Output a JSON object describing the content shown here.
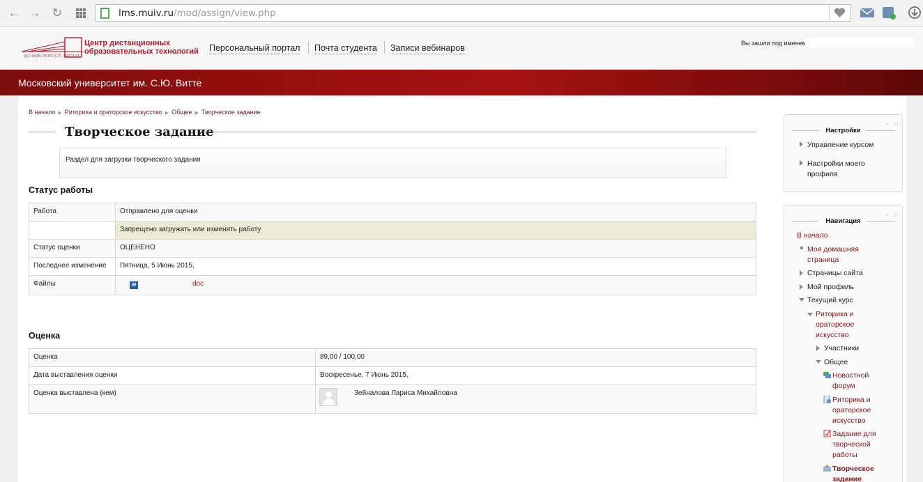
{
  "browser": {
    "url_host": "lms.muiv.ru",
    "url_path": "/mod/assign/view.php"
  },
  "header": {
    "logo_line1": "Центр дистанционных",
    "logo_line2": "образовательных технологий",
    "logo_motto": "QUI NON PROFICIT, DEFICIT",
    "nav": [
      "Персональный портал",
      "Почта студента",
      "Записи вебинаров"
    ],
    "login_label": "Вы зашли под именем"
  },
  "banner": {
    "title": "Московский университет им. С.Ю. Витте"
  },
  "breadcrumb": [
    "В начало",
    "Риторика и ораторское искусство",
    "Общее",
    "Творческое задание"
  ],
  "page": {
    "title": "Творческое задание",
    "intro": "Раздел для загрузки творческого задания"
  },
  "status": {
    "heading": "Статус работы",
    "rows": [
      {
        "label": "Работа",
        "value": "Отправлено для оценки"
      },
      {
        "label": "",
        "value": "Запрещено загружать или изменять работу"
      },
      {
        "label": "Статус оценки",
        "value": "ОЦЕНЕНО"
      },
      {
        "label": "Последнее изменение",
        "value": "Пятница, 5 Июнь 2015,"
      },
      {
        "label": "Файлы",
        "value": "doc"
      }
    ]
  },
  "grade": {
    "heading": "Оценка",
    "rows": [
      {
        "label": "Оценка",
        "value": "89,00 / 100,00"
      },
      {
        "label": "Дата выставления оценки",
        "value": "Воскресенье, 7 Июнь 2015,"
      },
      {
        "label": "Оценка выставлена (кем)",
        "value": "Зейналова Лариса Михайловна"
      }
    ]
  },
  "settings_block": {
    "title": "Настройки",
    "items": [
      "Управление курсом",
      "Настройки моего профиля"
    ]
  },
  "nav_block": {
    "title": "Навигация",
    "home": "В начало",
    "my_home": "Моя домашняя страница",
    "site_pages": "Страницы сайта",
    "my_profile": "Мой профиль",
    "current_course": "Текущий курс",
    "course": "Риторика и ораторское искусство",
    "participants": "Участники",
    "general": "Общее",
    "news_forum": "Новостной форум",
    "rhetoric": "Риторика и ораторское искусство",
    "creative_task_assignment": "Задание для творческой работы",
    "creative_task": "Творческое задание"
  },
  "colors": {
    "accent": "#8a1515",
    "banner": "#9a0f0f",
    "locked_row": "#ececd6"
  }
}
